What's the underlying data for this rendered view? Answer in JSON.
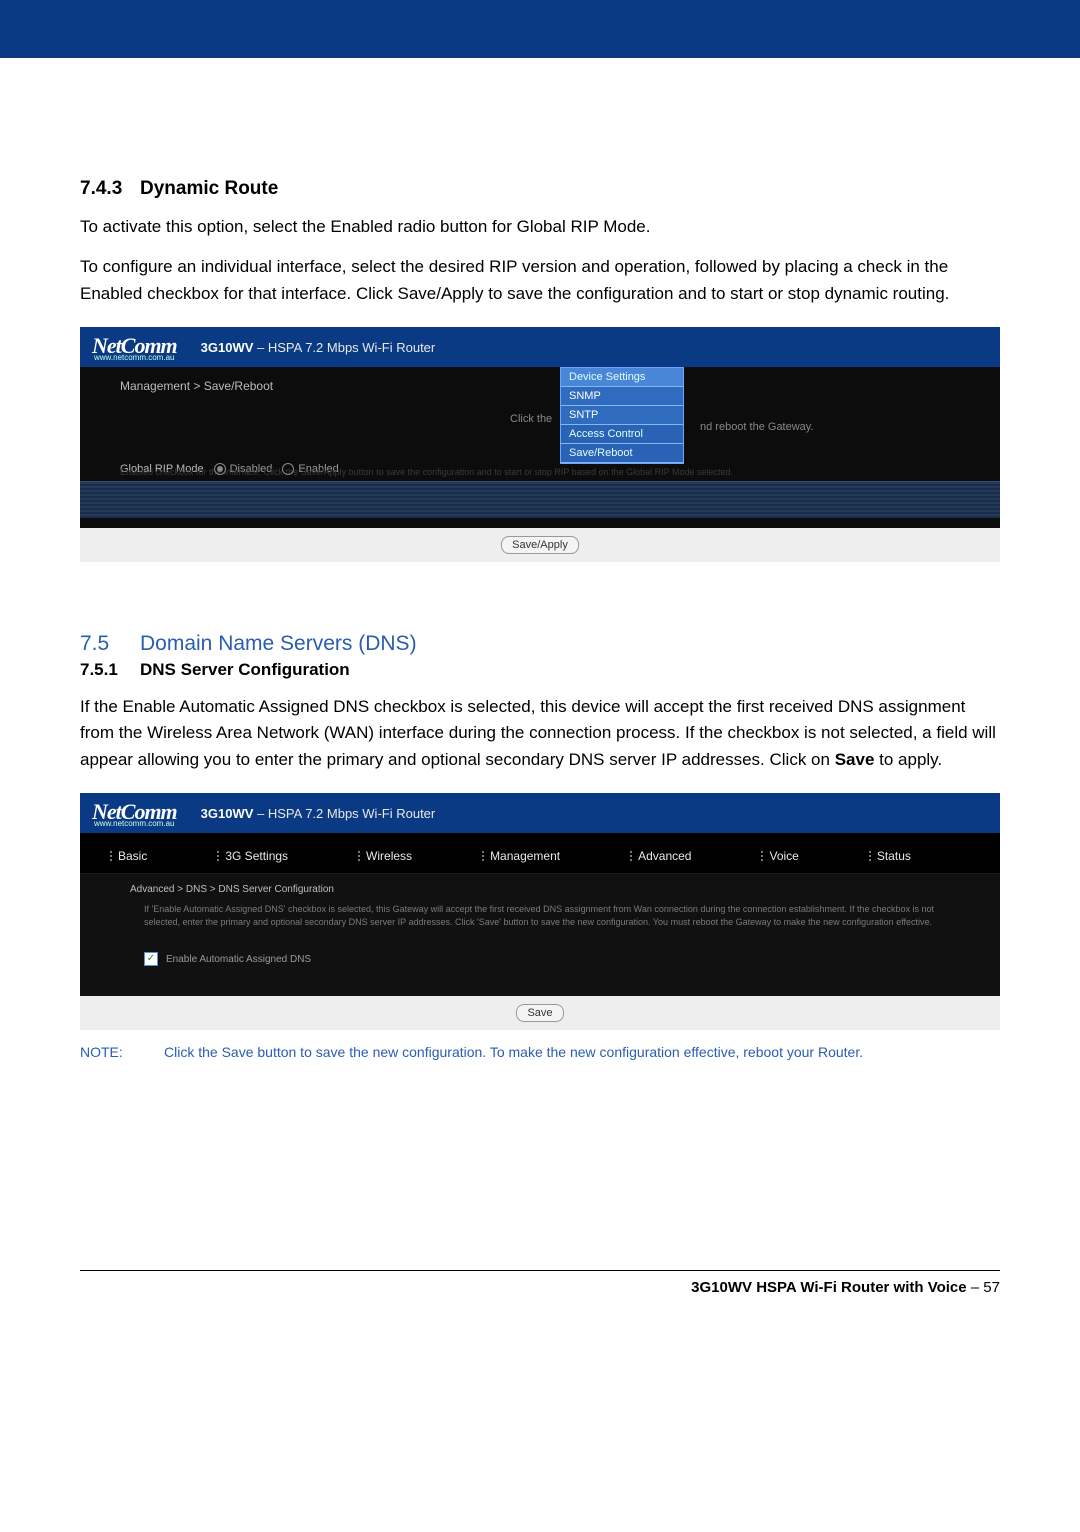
{
  "section1": {
    "num": "7.4.3",
    "title": "Dynamic Route",
    "p1": "To activate this option, select the Enabled radio button for Global RIP Mode.",
    "p2": "To configure an individual interface, select the desired RIP version and operation, followed by placing a check in the Enabled checkbox for that interface. Click Save/Apply to save the configuration and to start or stop dynamic routing."
  },
  "panel1": {
    "logo": "NetComm",
    "url": "www.netcomm.com.au",
    "model_strong": "3G10WV",
    "model_rest": " – HSPA 7.2 Mbps Wi-Fi Router",
    "breadcrumb": "Management > Save/Reboot",
    "click_the": "Click the",
    "after_menu": "nd reboot the Gateway.",
    "menu": {
      "i0": "Device Settings",
      "i1": "SNMP",
      "i2": "SNTP",
      "i3": "Access Control",
      "i4": "Save/Reboot"
    },
    "faint": "Enabled checkbox for the interface. Click the Save/Apply button to save the configuration and to start or stop RIP based on the Global RIP Mode selected.",
    "rip_label": "Global RIP Mode",
    "rip_disabled": "Disabled",
    "rip_enabled": "Enabled",
    "save_apply": "Save/Apply"
  },
  "section2": {
    "num": "7.5",
    "title": "Domain Name Servers (DNS)",
    "sub_num": "7.5.1",
    "sub_title": "DNS Server Configuration",
    "p1a": "If the Enable Automatic Assigned DNS checkbox is selected, this device will accept the first received DNS assignment from the Wireless Area Network (WAN) interface during the connection process. If the checkbox is not selected, a field will appear allowing you to enter the primary and optional secondary DNS server IP addresses. Click on ",
    "p1b": "Save",
    "p1c": " to apply."
  },
  "panel2": {
    "model_strong": "3G10WV",
    "model_rest": " – HSPA 7.2 Mbps Wi-Fi Router",
    "nav": {
      "n0": "Basic",
      "n1": "3G Settings",
      "n2": "Wireless",
      "n3": "Management",
      "n4": "Advanced",
      "n5": "Voice",
      "n6": "Status"
    },
    "breadcrumb": "Advanced > DNS > DNS Server Configuration",
    "desc": "If 'Enable Automatic Assigned DNS' checkbox is selected, this Gateway will accept the first received DNS assignment from Wan connection during the connection establishment. If the checkbox is not selected, enter the primary and optional secondary DNS server IP addresses. Click 'Save' button to save the new configuration. You must reboot the Gateway to make the new configuration effective.",
    "chk_label": "Enable Automatic Assigned DNS",
    "save": "Save"
  },
  "note": {
    "label": "NOTE:",
    "text": "Click the Save button to save the new configuration. To make the new configuration effective, reboot your Router."
  },
  "footer": {
    "bold": "3G10WV HSPA Wi-Fi Router with Voice",
    "rest": " – 57"
  }
}
